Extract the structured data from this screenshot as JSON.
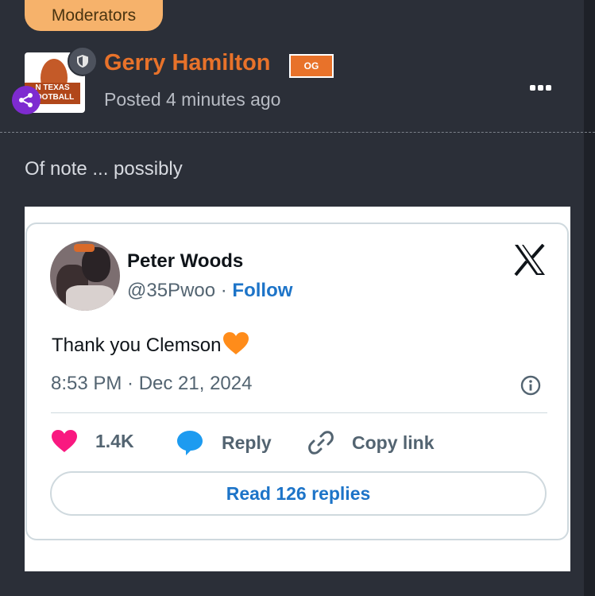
{
  "group_badge": "Moderators",
  "author": {
    "name": "Gerry Hamilton",
    "rank_badge": "OG",
    "posted": "Posted 4 minutes ago",
    "avatar_text": "N TEXAS FOOTBALL"
  },
  "post": {
    "text": "Of note ... possibly"
  },
  "tweet": {
    "name": "Peter Woods",
    "handle": "@35Pwoo",
    "separator": " · ",
    "follow": "Follow",
    "text": "Thank you Clemson",
    "time": "8:53 PM · Dec 21, 2024",
    "likes": "1.4K",
    "reply": "Reply",
    "copy_link": "Copy link",
    "read_replies": "Read 126 replies"
  },
  "colors": {
    "background": "#2b2f38",
    "accent_orange": "#e8722a",
    "moderator_badge": "#f6b26b",
    "link_blue": "#1d74c8",
    "like_pink": "#f91880",
    "reply_blue": "#1d9bf0"
  },
  "icons": [
    "shield-icon",
    "share-icon",
    "more-icon",
    "x-logo-icon",
    "orange-heart-emoji",
    "info-icon",
    "heart-icon",
    "reply-bubble-icon",
    "link-icon"
  ]
}
